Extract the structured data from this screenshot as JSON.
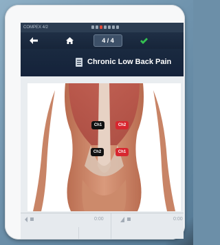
{
  "status": {
    "device_name": "COMPEX 4/2"
  },
  "nav": {
    "page_indicator": "4 / 4"
  },
  "program": {
    "title": "Chronic Low Back Pain"
  },
  "electrodes": [
    {
      "label": "Ch1",
      "color": "black"
    },
    {
      "label": "Ch2",
      "color": "red"
    },
    {
      "label": "Ch2",
      "color": "black"
    },
    {
      "label": "Ch1",
      "color": "red"
    }
  ],
  "bottom": {
    "left_time": "0:00",
    "right_time": "0:00"
  },
  "colors": {
    "accent_red": "#d8262f",
    "nav_bg": "#17253a",
    "check_green": "#35c251"
  }
}
